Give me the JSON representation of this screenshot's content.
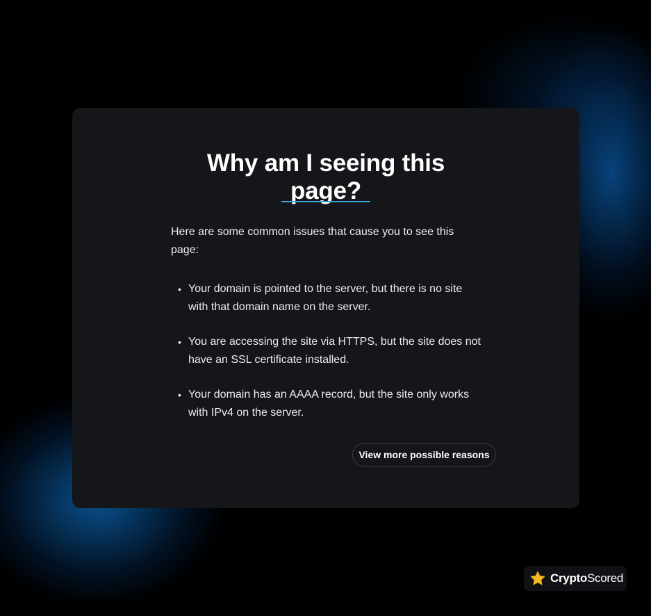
{
  "page": {
    "title": "Why am I seeing this page?",
    "intro": "Here are some common issues that cause you to see this page:",
    "issues": [
      "Your domain is pointed to the server, but there is no site with that domain name on the server.",
      "You are accessing the site via HTTPS, but the site does not have an SSL certificate installed.",
      "Your domain has an AAAA record, but the site only works with IPv4 on the server."
    ],
    "more_button_label": "View more possible reasons"
  },
  "badge": {
    "brand_bold": "Crypto",
    "brand_regular": "Scored",
    "icon": "star-icon"
  },
  "colors": {
    "accent": "#3fa2d9",
    "card_background": "#141619",
    "page_background": "#000000",
    "star": "#f5b820"
  }
}
